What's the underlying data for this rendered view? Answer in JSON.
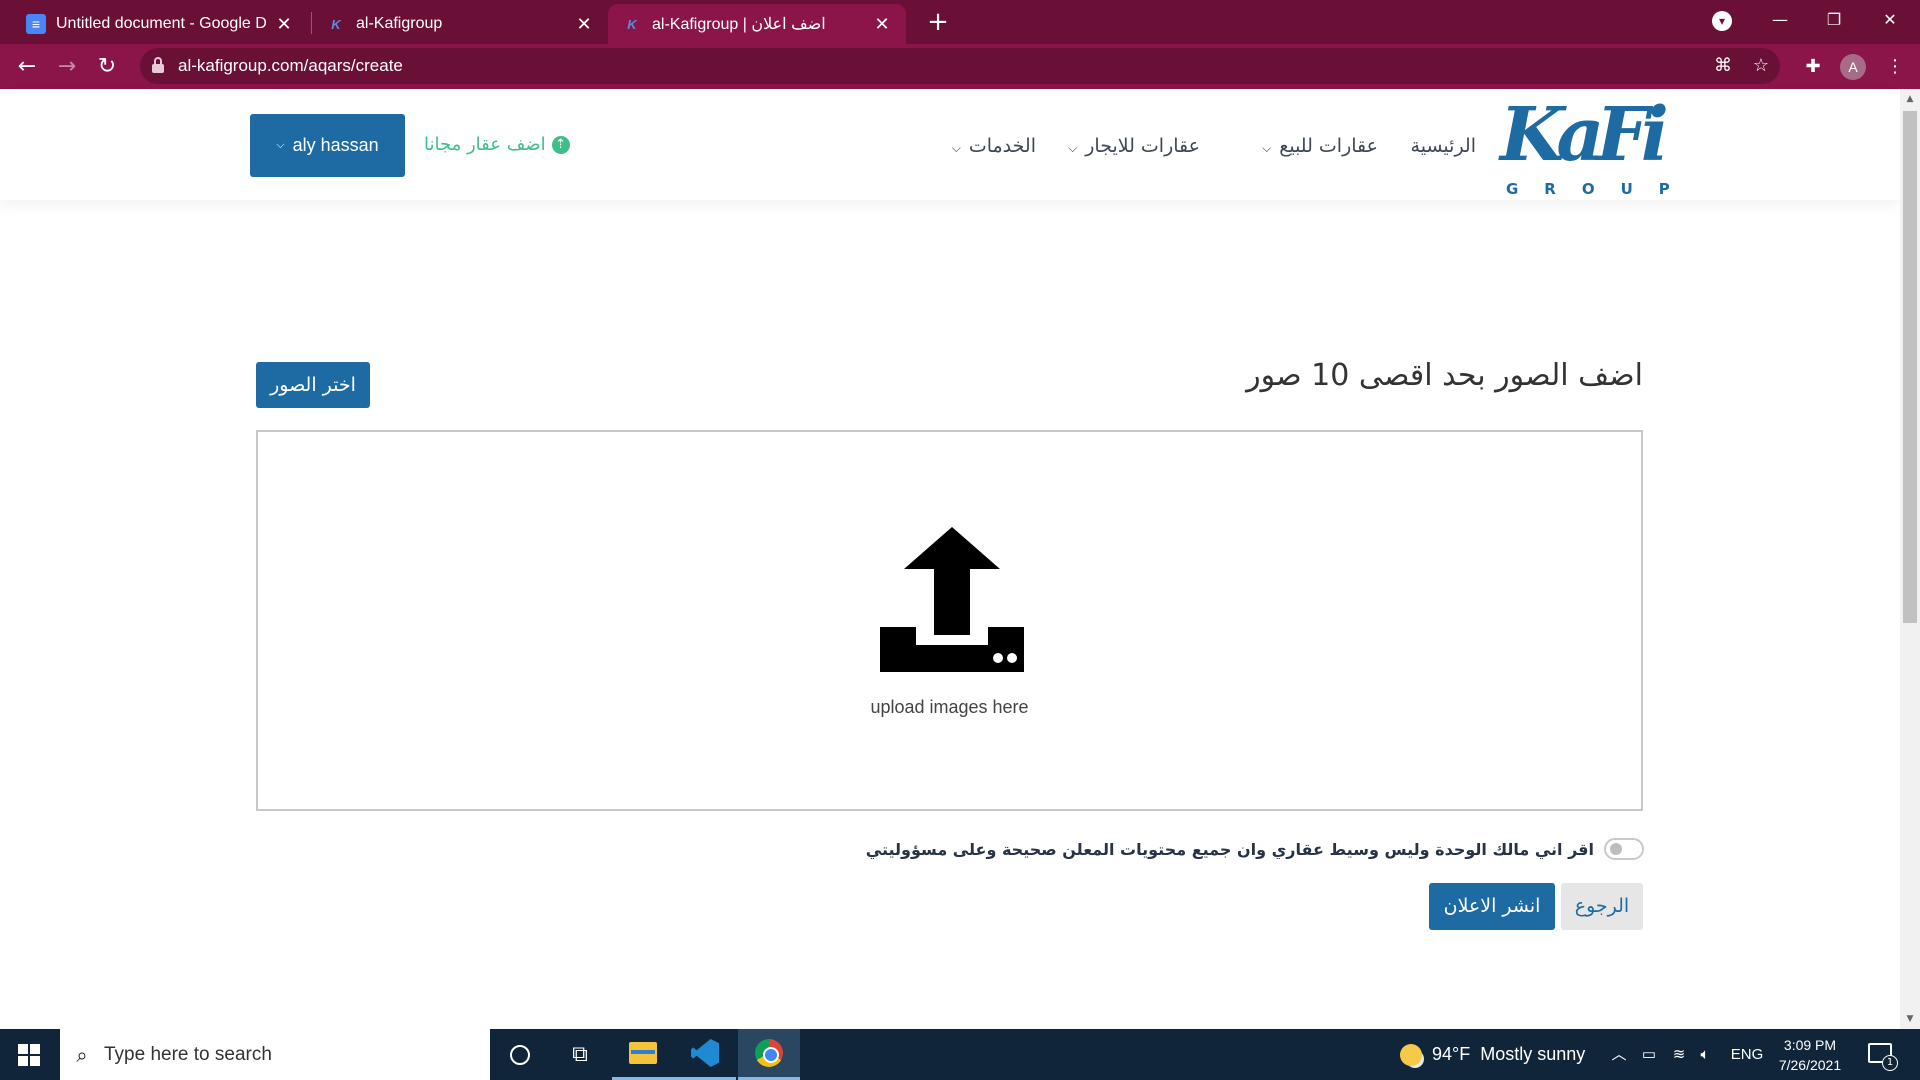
{
  "browser": {
    "tabs": [
      {
        "title": "Untitled document - Google Docs",
        "favicon": "docs-icon"
      },
      {
        "title": "al-Kafigroup",
        "favicon": "kafi-icon"
      },
      {
        "title": "al-Kafigroup | اضف اعلان",
        "favicon": "kafi-icon",
        "active": true
      }
    ],
    "new_tab_label": "+",
    "url": "al-kafigroup.com/aqars/create",
    "profile_initial": "A",
    "colors": {
      "tabstrip": "#6a0f36",
      "toolbar": "#8b1548"
    }
  },
  "site": {
    "logo": {
      "word": "KaFi",
      "sub": "GROUP"
    },
    "nav": [
      {
        "label": "الرئيسية",
        "has_dropdown": false
      },
      {
        "label": "عقارات للبيع",
        "has_dropdown": true
      },
      {
        "label": "عقارات للايجار",
        "has_dropdown": true
      },
      {
        "label": "الخدمات",
        "has_dropdown": true
      }
    ],
    "add_free_label": "اضف عقار مجانا",
    "user_label": "aly hassan",
    "colors": {
      "primary": "#1e6aa3",
      "accent_green": "#3fbf88"
    }
  },
  "form": {
    "title": "اضف الصور بحد اقصى 10 صور",
    "choose_button": "اختر الصور",
    "upload_text": "upload images here",
    "confirm_text": "اقر اني مالك الوحدة وليس وسيط عقاري وان جميع محتويات المعلن صحيحة وعلى مسؤوليتي",
    "confirm_checked": false,
    "publish_button": "انشر الاعلان",
    "back_button": "الرجوع"
  },
  "taskbar": {
    "search_placeholder": "Type here to search",
    "weather": {
      "temp": "94°F",
      "condition": "Mostly sunny"
    },
    "language": "ENG",
    "time": "3:09 PM",
    "date": "7/26/2021",
    "notifications_count": "1"
  }
}
